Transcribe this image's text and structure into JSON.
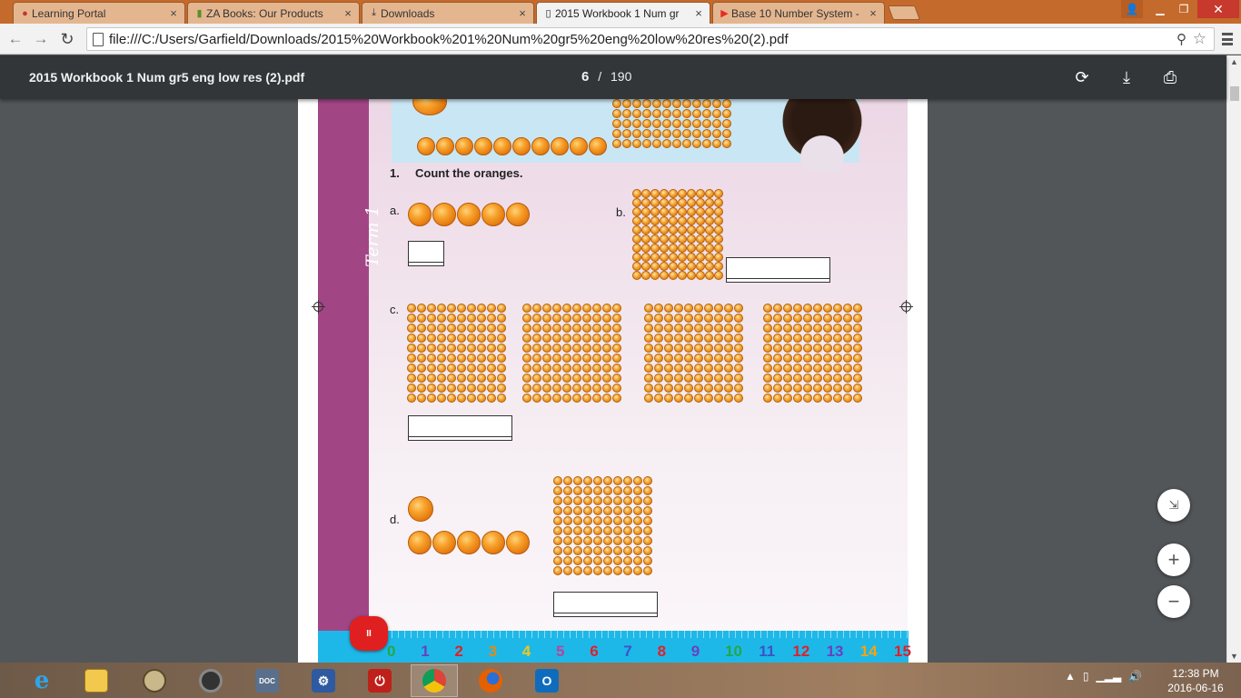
{
  "browser": {
    "tabs": [
      {
        "title": "Learning Portal",
        "icon": "portal-icon",
        "active": false
      },
      {
        "title": "ZA Books: Our Products",
        "icon": "books-icon",
        "active": false
      },
      {
        "title": "Downloads",
        "icon": "download-icon",
        "active": false
      },
      {
        "title": "2015 Workbook 1 Num gr",
        "icon": "page-icon",
        "active": true
      },
      {
        "title": "Base 10 Number System -",
        "icon": "youtube-icon",
        "active": false
      }
    ],
    "url": "file:///C:/Users/Garfield/Downloads/2015%20Workbook%201%20Num%20gr5%20eng%20low%20res%20(2).pdf"
  },
  "pdf": {
    "title": "2015 Workbook 1 Num gr5 eng low res (2).pdf",
    "current_page": "6",
    "separator": "/",
    "total_pages": "190"
  },
  "worksheet": {
    "term_label": "Term 1",
    "question_number": "1.",
    "question_text": "Count the oranges.",
    "labels": {
      "a": "a.",
      "b": "b.",
      "c": "c.",
      "d": "d."
    },
    "number_line": [
      "0",
      "1",
      "2",
      "3",
      "4",
      "5",
      "6",
      "7",
      "8",
      "9",
      "10",
      "11",
      "12",
      "13",
      "14",
      "15"
    ],
    "number_colors": [
      "#22a84a",
      "#6a3fbf",
      "#e0202a",
      "#e48a12",
      "#f0c818",
      "#b8449b",
      "#e0202a",
      "#3a55c8",
      "#e0202a",
      "#6a3fbf",
      "#22a84a",
      "#3a55c8",
      "#e0202a",
      "#6a3fbf",
      "#f5a312",
      "#e0202a"
    ]
  },
  "player": {
    "pause_label": "II"
  },
  "zoom": {
    "fit_icon": "fit-to-page-icon",
    "in_label": "+",
    "out_label": "−"
  },
  "taskbar": {
    "apps": [
      "internet-explorer-icon",
      "file-explorer-icon",
      "media-app-icon",
      "speaker-app-icon",
      "doc-app-icon",
      "settings-app-icon",
      "power-app-icon",
      "chrome-icon",
      "firefox-icon",
      "outlook-icon"
    ],
    "time": "12:38 PM",
    "date": "2016-06-16"
  }
}
